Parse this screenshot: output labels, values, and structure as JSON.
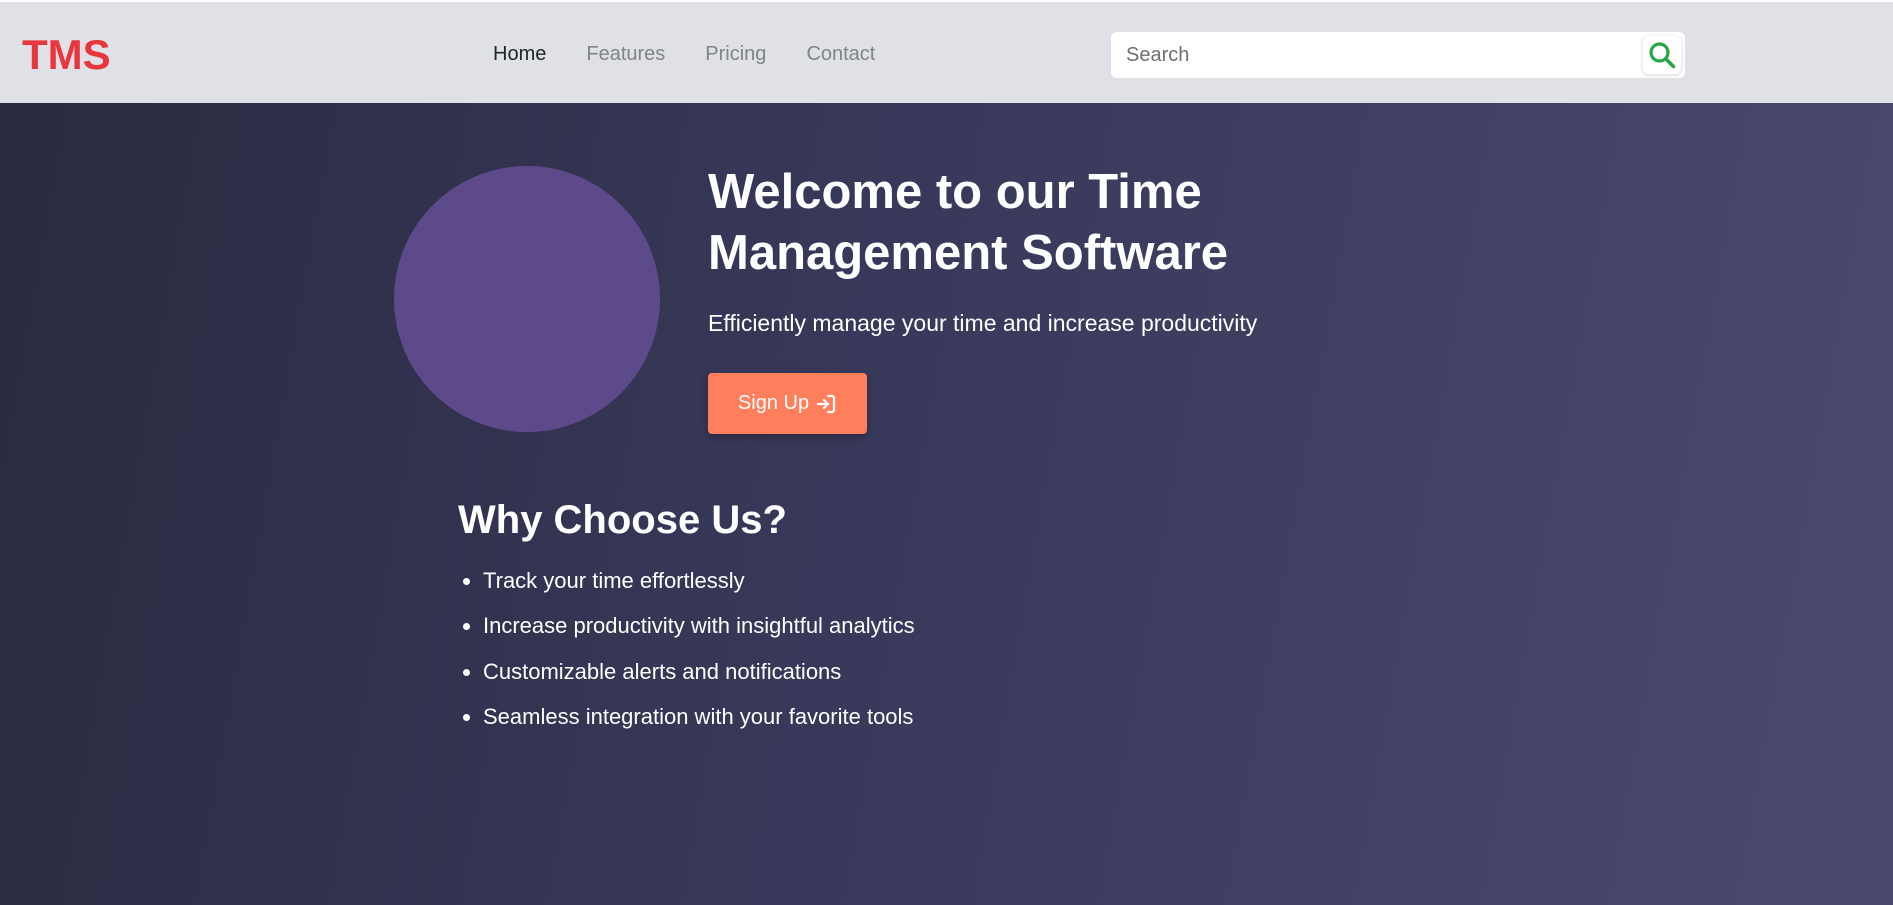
{
  "navbar": {
    "brand": "TMS",
    "links": [
      {
        "label": "Home",
        "active": true
      },
      {
        "label": "Features",
        "active": false
      },
      {
        "label": "Pricing",
        "active": false
      },
      {
        "label": "Contact",
        "active": false
      }
    ],
    "search": {
      "placeholder": "Search",
      "value": "",
      "icon": "search-icon"
    }
  },
  "hero": {
    "title": "Welcome to our Time Management Software",
    "subtitle": "Efficiently manage your time and increase productivity",
    "cta_label": "Sign Up",
    "cta_icon": "sign-in-icon"
  },
  "why": {
    "title": "Why Choose Us?",
    "items": [
      "Track your time effortlessly",
      "Increase productivity with insightful analytics",
      "Customizable alerts and notifications",
      "Seamless integration with your favorite tools"
    ]
  },
  "colors": {
    "brand": "#e8363d",
    "navbar_bg": "#dfe1e6",
    "search_icon": "#28a745",
    "circle": "#5c4a8a",
    "cta": "#ff7f5c",
    "bg_start": "#2a2a40",
    "bg_end": "#4a4a6d"
  }
}
